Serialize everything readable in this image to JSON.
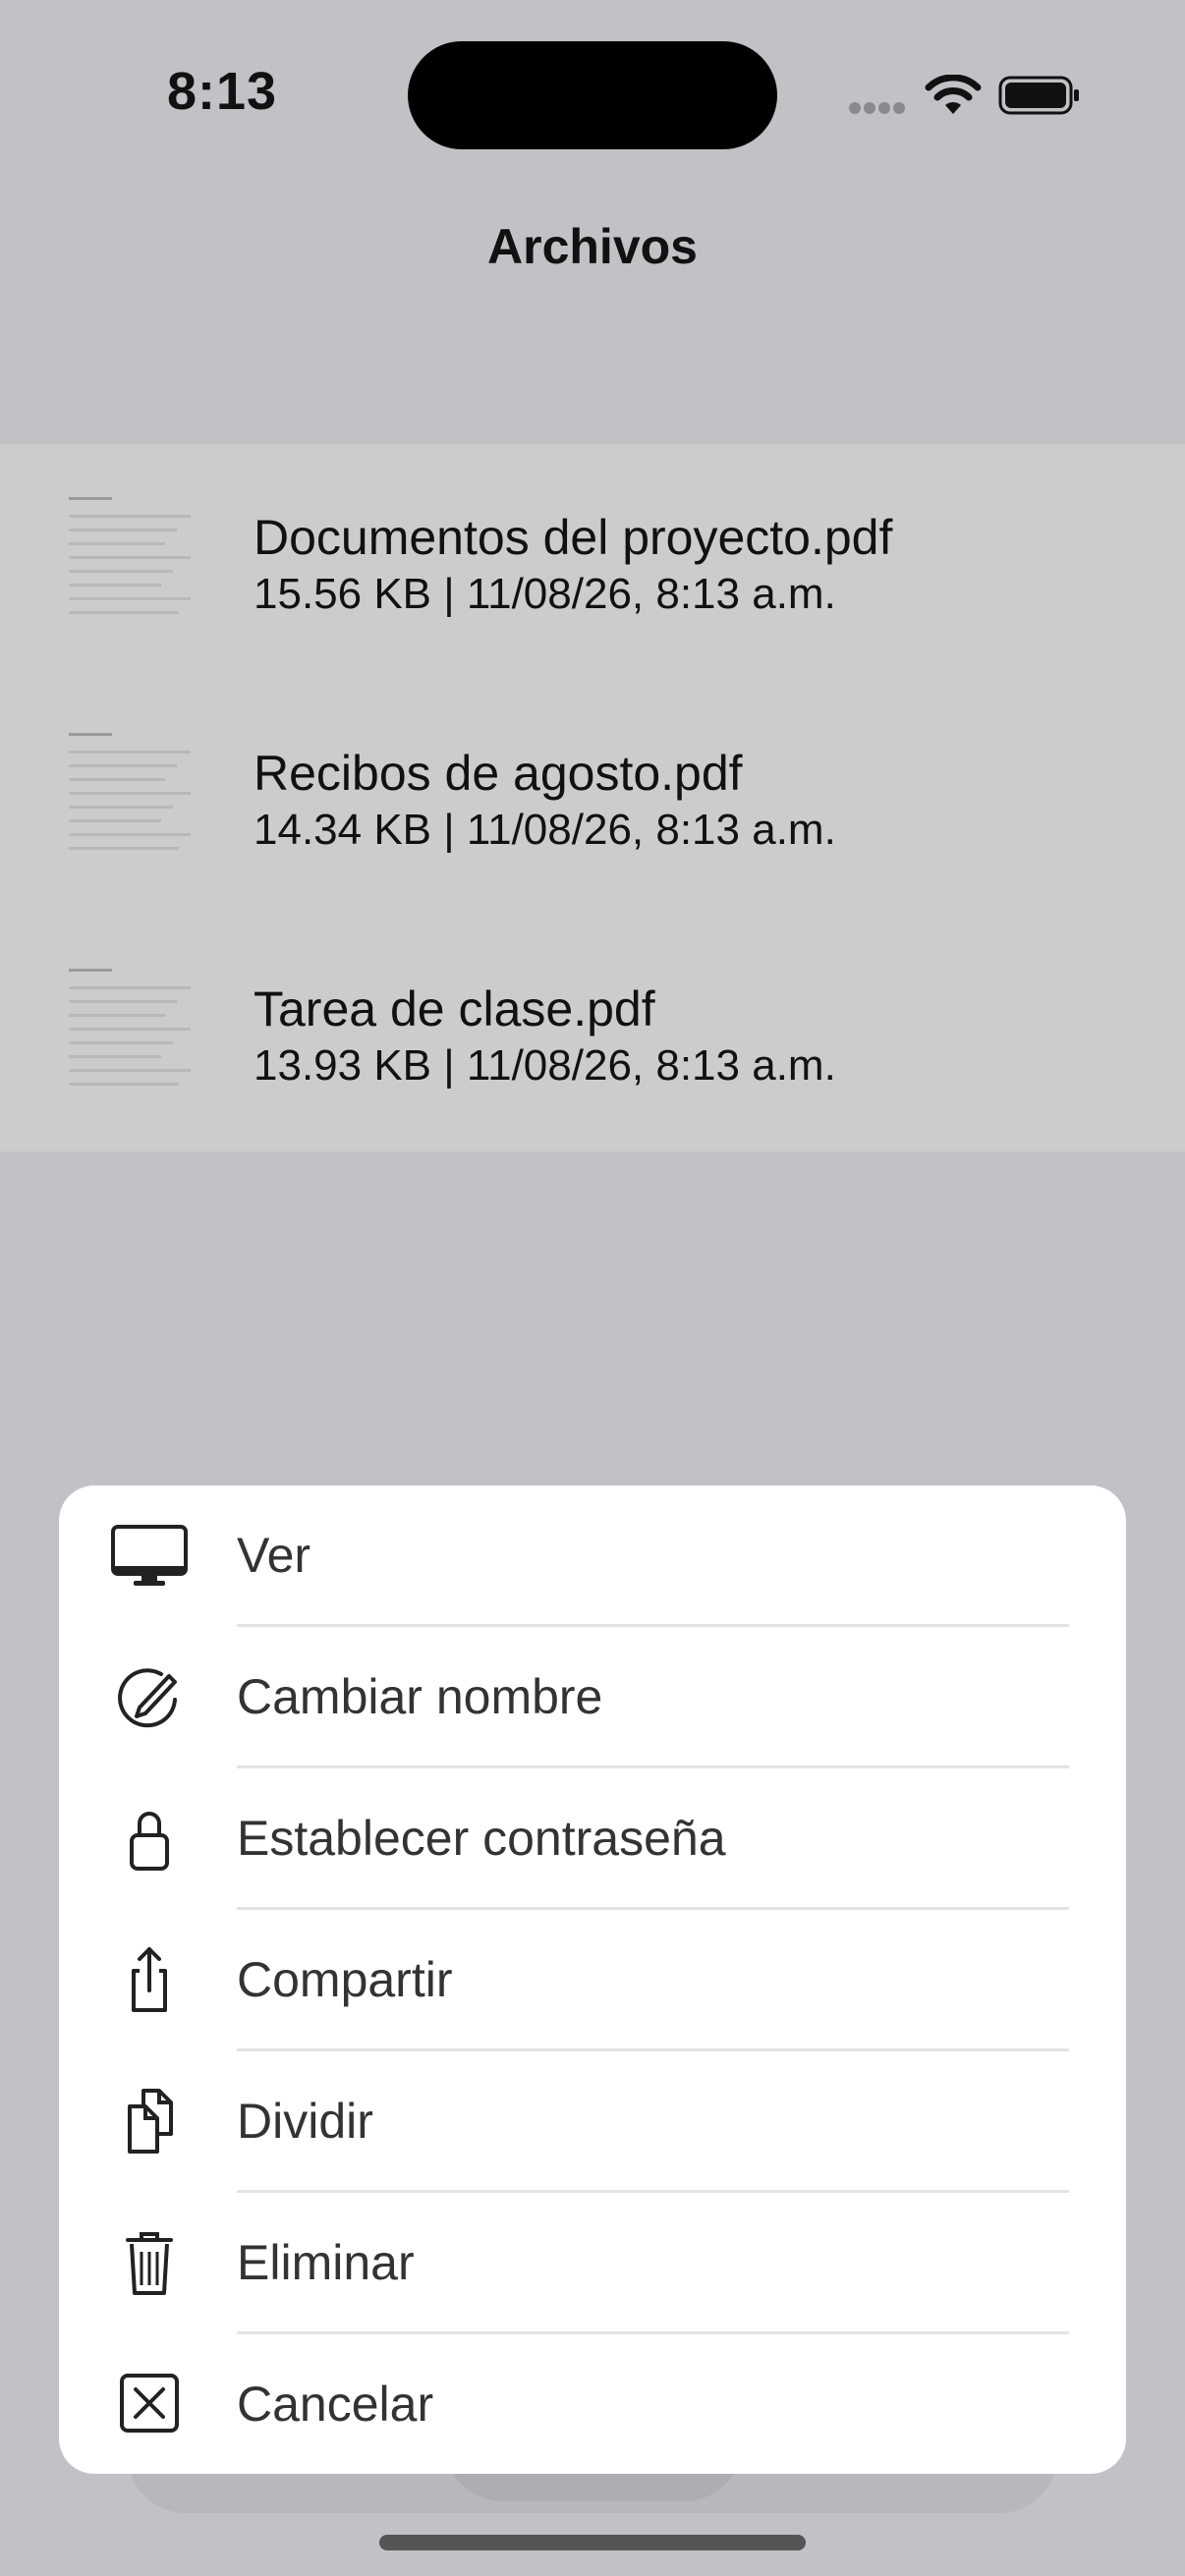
{
  "status_bar": {
    "time": "8:13"
  },
  "nav": {
    "title": "Archivos"
  },
  "files": [
    {
      "name": "Documentos del proyecto.pdf",
      "meta": "15.56 KB | 11/08/26, 8:13 a.m."
    },
    {
      "name": "Recibos de agosto.pdf",
      "meta": "14.34 KB | 11/08/26, 8:13 a.m."
    },
    {
      "name": "Tarea de clase.pdf",
      "meta": "13.93 KB | 11/08/26, 8:13 a.m."
    }
  ],
  "action_sheet": {
    "items": [
      {
        "label": "Ver",
        "icon": "display-icon"
      },
      {
        "label": "Cambiar nombre",
        "icon": "rename-pencil-icon"
      },
      {
        "label": "Establecer contraseña",
        "icon": "lock-icon"
      },
      {
        "label": "Compartir",
        "icon": "share-icon"
      },
      {
        "label": "Dividir",
        "icon": "split-documents-icon"
      },
      {
        "label": "Eliminar",
        "icon": "trash-icon"
      },
      {
        "label": "Cancelar",
        "icon": "close-box-icon"
      }
    ]
  },
  "colors": {
    "dimmed_background": "#c1c1c6",
    "list_background": "#cccccc",
    "sheet_background": "#ffffff",
    "separator": "#e3e3e6"
  }
}
